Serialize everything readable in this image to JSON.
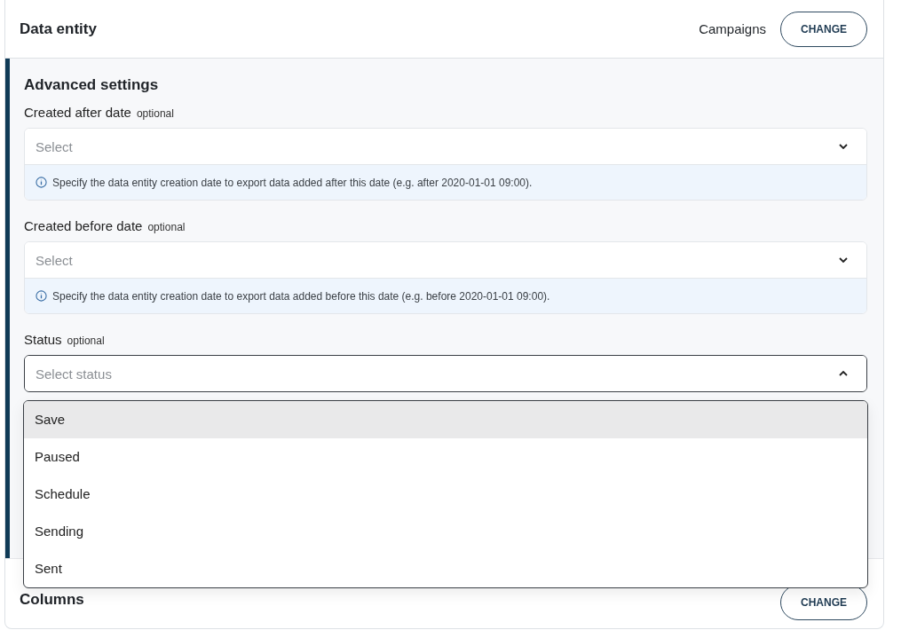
{
  "header": {
    "title": "Data entity",
    "value": "Campaigns",
    "button": "CHANGE"
  },
  "advanced": {
    "title": "Advanced settings",
    "fields": [
      {
        "label": "Created after date",
        "optional": "optional",
        "placeholder": "Select",
        "expanded": false,
        "hint": "Specify the data entity creation date to export data added after this date (e.g. after 2020-01-01 09:00)."
      },
      {
        "label": "Created before date",
        "optional": "optional",
        "placeholder": "Select",
        "expanded": false,
        "hint": "Specify the data entity creation date to export data added before this date (e.g. before 2020-01-01 09:00)."
      },
      {
        "label": "Status",
        "optional": "optional",
        "placeholder": "Select status",
        "expanded": true
      }
    ]
  },
  "status_menu": [
    {
      "label": "Save",
      "highlighted": true
    },
    {
      "label": "Paused",
      "highlighted": false
    },
    {
      "label": "Schedule",
      "highlighted": false
    },
    {
      "label": "Sending",
      "highlighted": false
    },
    {
      "label": "Sent",
      "highlighted": false
    }
  ],
  "columns": {
    "title": "Columns",
    "button": "CHANGE"
  }
}
